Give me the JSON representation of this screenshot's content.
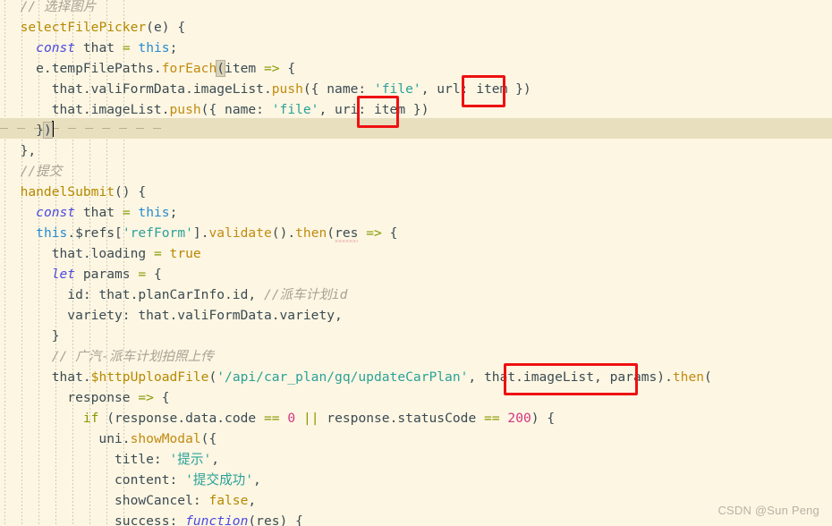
{
  "editor": {
    "background_color": "#FDF6E3",
    "current_line_highlight_color": "#E8DFBF",
    "annotation_color": "#EE1111",
    "language": "javascript"
  },
  "watermark": {
    "text": "CSDN @Sun  Peng"
  },
  "annotations": [
    {
      "name": "url-key-highlight",
      "label": "url:",
      "line": 5
    },
    {
      "name": "uri-key-highlight",
      "label": "uri:",
      "line": 6
    },
    {
      "name": "imagelist-arg-highlight",
      "label": "that.imageList",
      "line": 18
    }
  ],
  "code_lines": [
    {
      "n": 1,
      "indent": 2,
      "text": "// 选择图片"
    },
    {
      "n": 2,
      "indent": 2,
      "text": "selectFilePicker(e) {"
    },
    {
      "n": 3,
      "indent": 3,
      "text": "const that = this;"
    },
    {
      "n": 4,
      "indent": 3,
      "text": "e.tempFilePaths.forEach(item => {"
    },
    {
      "n": 5,
      "indent": 4,
      "text": "that.valiFormData.imageList.push({ name: 'file', url: item })"
    },
    {
      "n": 6,
      "indent": 4,
      "text": "that.imageList.push({ name: 'file', uri: item })"
    },
    {
      "n": 7,
      "indent": 3,
      "text": "})"
    },
    {
      "n": 8,
      "indent": 2,
      "text": "},"
    },
    {
      "n": 9,
      "indent": 2,
      "text": "//提交"
    },
    {
      "n": 10,
      "indent": 2,
      "text": "handelSubmit() {"
    },
    {
      "n": 11,
      "indent": 3,
      "text": "const that = this;"
    },
    {
      "n": 12,
      "indent": 3,
      "text": "this.$refs['refForm'].validate().then(res => {"
    },
    {
      "n": 13,
      "indent": 4,
      "text": "that.loading = true"
    },
    {
      "n": 14,
      "indent": 4,
      "text": "let params = {"
    },
    {
      "n": 15,
      "indent": 5,
      "text": "id: that.planCarInfo.id, //派车计划id"
    },
    {
      "n": 16,
      "indent": 5,
      "text": "variety: that.valiFormData.variety,"
    },
    {
      "n": 17,
      "indent": 4,
      "text": "}"
    },
    {
      "n": 18,
      "indent": 4,
      "text": "// 广汽-派车计划拍照上传"
    },
    {
      "n": 19,
      "indent": 4,
      "text": "that.$httpUploadFile('/api/car_plan/gq/updateCarPlan', that.imageList, params).then("
    },
    {
      "n": 20,
      "indent": 5,
      "text": "response => {"
    },
    {
      "n": 21,
      "indent": 6,
      "text": "if (response.data.code == 0 || response.statusCode == 200) {"
    },
    {
      "n": 22,
      "indent": 7,
      "text": "uni.showModal({"
    },
    {
      "n": 23,
      "indent": 8,
      "text": "title: '提示',"
    },
    {
      "n": 24,
      "indent": 8,
      "text": "content: '提交成功',"
    },
    {
      "n": 25,
      "indent": 8,
      "text": "showCancel: false,"
    },
    {
      "n": 26,
      "indent": 8,
      "text": "success: function(res) {"
    }
  ],
  "tokens": {
    "comment_select_image": "// 选择图片",
    "comment_submit": "//提交",
    "comment_plan_id": "//派车计划id",
    "comment_gac_upload": "// 广汽-派车计划拍照上传",
    "fn_select_file_picker": "selectFilePicker",
    "fn_handel_submit": "handelSubmit",
    "fn_for_each": "forEach",
    "fn_push": "push",
    "fn_validate": "validate",
    "fn_then": "then",
    "fn_http_upload_file": "$httpUploadFile",
    "fn_show_modal": "showModal",
    "kw_const": "const",
    "kw_let": "let",
    "kw_this": "this",
    "kw_function": "function",
    "kw_if": "if",
    "str_file": "'file'",
    "str_ref_form": "'refForm'",
    "str_api_path": "'/api/car_plan/gq/updateCarPlan'",
    "str_title_hint": "'提示'",
    "str_content_success": "'提交成功'",
    "val_true": "true",
    "val_false": "false",
    "num_zero": "0",
    "num_two_hundred": "200"
  }
}
